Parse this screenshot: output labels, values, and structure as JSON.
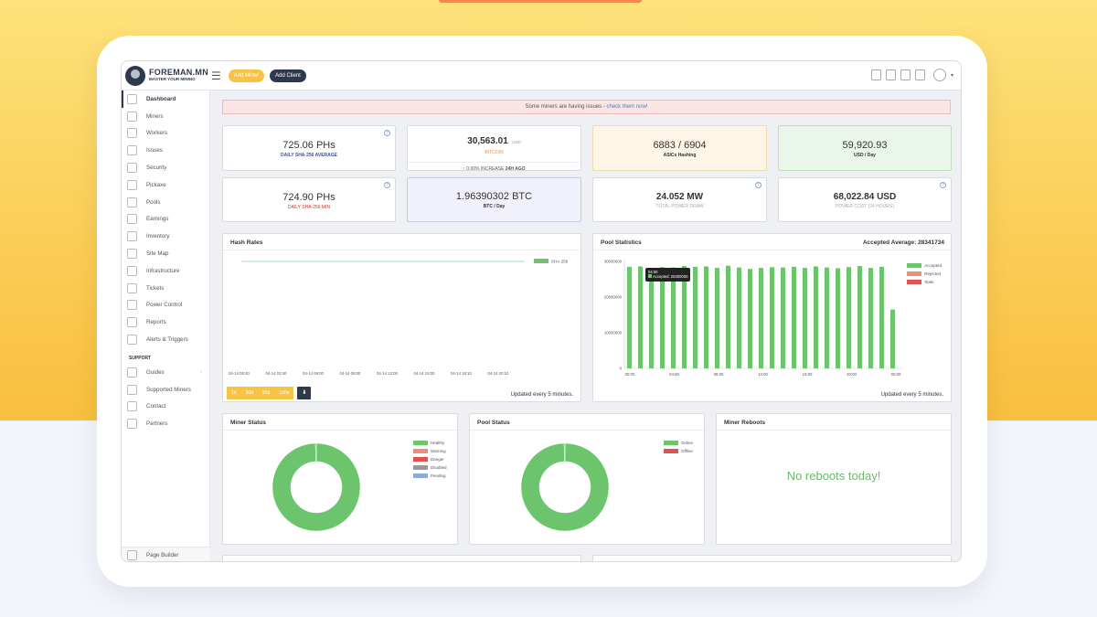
{
  "brand": {
    "title": "FOREMAN.MN",
    "tagline": "MASTER YOUR MINING"
  },
  "header": {
    "add_miner": "Add Miner",
    "add_client": "Add Client"
  },
  "alert": {
    "text": "Some miners are having issues - ",
    "link": "check them now!"
  },
  "sidebar": {
    "items": [
      {
        "label": "Dashboard",
        "icon": "dashboard-icon"
      },
      {
        "label": "Miners",
        "icon": "miners-icon"
      },
      {
        "label": "Workers",
        "icon": "workers-icon"
      },
      {
        "label": "Issues",
        "icon": "issues-icon"
      },
      {
        "label": "Security",
        "icon": "security-icon"
      },
      {
        "label": "Pickaxe",
        "icon": "pickaxe-icon"
      },
      {
        "label": "Pools",
        "icon": "pools-icon"
      },
      {
        "label": "Earnings",
        "icon": "earnings-icon"
      },
      {
        "label": "Inventory",
        "icon": "inventory-icon"
      },
      {
        "label": "Site Map",
        "icon": "site-map-icon"
      },
      {
        "label": "Infrastructure",
        "icon": "infrastructure-icon"
      },
      {
        "label": "Tickets",
        "icon": "tickets-icon"
      },
      {
        "label": "Power Control",
        "icon": "power-icon"
      },
      {
        "label": "Reports",
        "icon": "reports-icon"
      },
      {
        "label": "Alerts & Triggers",
        "icon": "bell-icon"
      }
    ],
    "support_label": "SUPPORT",
    "support_items": [
      {
        "label": "Guides",
        "icon": "guides-icon"
      },
      {
        "label": "Supported Miners",
        "icon": "supported-miners-icon"
      },
      {
        "label": "Contact",
        "icon": "contact-icon"
      },
      {
        "label": "Partners",
        "icon": "partners-icon"
      }
    ],
    "page_builder": "Page Builder"
  },
  "stats": {
    "hash_avg": {
      "value": "725.06 PHs",
      "label": "DAILY SHA-256 AVERAGE",
      "color": "#3b4ea8"
    },
    "btc_price": {
      "value": "30,563.01",
      "unit": "USD",
      "label": "BITCOIN",
      "increase": "0.00% INCREASE",
      "period": "24H AGO"
    },
    "asics": {
      "value": "6883 / 6904",
      "label": "ASICs Hashing",
      "bg": "#fdf5e6"
    },
    "usd_day": {
      "value": "59,920.93",
      "label": "USD / Day",
      "bg": "#eaf6ea"
    },
    "hash_min": {
      "value": "724.90 PHs",
      "label": "DAILY SHA-256 MIN",
      "color": "#c0392b"
    },
    "btc_day": {
      "value": "1.96390302 BTC",
      "label": "BTC / Day",
      "bg": "#f1f1fb"
    },
    "power": {
      "value": "24.052 MW",
      "label": "TOTAL POWER DRAW"
    },
    "power_cost": {
      "value": "68,022.84 USD",
      "label": "POWER COST (24 HOURS)"
    }
  },
  "hash_rates": {
    "title": "Hash Rates",
    "legend": "SHA-256",
    "x_ticks": [
      "04-14 00:40",
      "04-14 03:40",
      "04-14 06:00",
      "04-14 09:00",
      "04-14 12:00",
      "04-14 15:00",
      "04-14 18:10",
      "04-14 20:10"
    ],
    "tabs": [
      "1d",
      "30d",
      "90d",
      "180d"
    ],
    "download": "⬇",
    "updated": "Updated every 5 minutes."
  },
  "pool_stats": {
    "title": "Pool Statistics",
    "accepted_avg": "Accepted Average: 28341734",
    "tooltip_time": "04:00",
    "tooltip_value": "Accepted: 28300000",
    "legend": [
      "Accepted",
      "Rejected",
      "Stale"
    ],
    "updated": "Updated every 5 minutes."
  },
  "miner_status": {
    "title": "Miner Status",
    "legend": [
      "Healthy",
      "Warning",
      "Danger",
      "Disabled",
      "Pending"
    ]
  },
  "pool_status": {
    "title": "Pool Status",
    "legend": [
      "Online",
      "Offline"
    ]
  },
  "miner_reboots": {
    "title": "Miner Reboots",
    "message": "No reboots today!"
  },
  "chart_data": [
    {
      "type": "line",
      "title": "Hash Rates",
      "series": [
        {
          "name": "SHA-256",
          "values": [
            725,
            725,
            725,
            725,
            725,
            725,
            725,
            725
          ]
        }
      ],
      "categories": [
        "04-14 00:40",
        "04-14 03:40",
        "04-14 06:00",
        "04-14 09:00",
        "04-14 12:00",
        "04-14 15:00",
        "04-14 18:10",
        "04-14 20:10"
      ]
    },
    {
      "type": "bar",
      "title": "Pool Statistics",
      "categories": [
        "00:00",
        "01:00",
        "02:00",
        "03:00",
        "04:00",
        "05:00",
        "06:00",
        "07:00",
        "08:00",
        "09:00",
        "10:00",
        "11:00",
        "12:00",
        "13:00",
        "14:00",
        "15:00",
        "16:00",
        "17:00",
        "18:00",
        "19:00",
        "20:00",
        "21:00",
        "22:00",
        "23:00"
      ],
      "x_ticks": [
        "00:00",
        "04:00",
        "08:00",
        "12:00",
        "16:00",
        "20:00",
        "00:00"
      ],
      "y_ticks": [
        "0",
        "10000000",
        "20000000",
        "30000000"
      ],
      "ylim": [
        0,
        30000000
      ],
      "series": [
        {
          "name": "Accepted",
          "color": "#6cc46c",
          "values": [
            28500000,
            28600000,
            28200000,
            28400000,
            28300000,
            28700000,
            28500000,
            28600000,
            28200000,
            28800000,
            28300000,
            27900000,
            28200000,
            28400000,
            28300000,
            28500000,
            28200000,
            28600000,
            28300000,
            28100000,
            28400000,
            28700000,
            28200000,
            28500000,
            16500000
          ]
        },
        {
          "name": "Rejected",
          "color": "#e8917a",
          "values": []
        },
        {
          "name": "Stale",
          "color": "#e05252",
          "values": []
        }
      ]
    },
    {
      "type": "pie",
      "title": "Miner Status",
      "categories": [
        "Healthy",
        "Warning",
        "Danger",
        "Disabled",
        "Pending"
      ],
      "values": [
        6883,
        0,
        21,
        0,
        0
      ],
      "colors": [
        "#6cc46c",
        "#e8917a",
        "#e05252",
        "#999999",
        "#8ea9dd"
      ]
    },
    {
      "type": "pie",
      "title": "Pool Status",
      "categories": [
        "Online",
        "Offline"
      ],
      "values": [
        99.7,
        0.3
      ],
      "colors": [
        "#6cc46c",
        "#e05252"
      ]
    }
  ]
}
